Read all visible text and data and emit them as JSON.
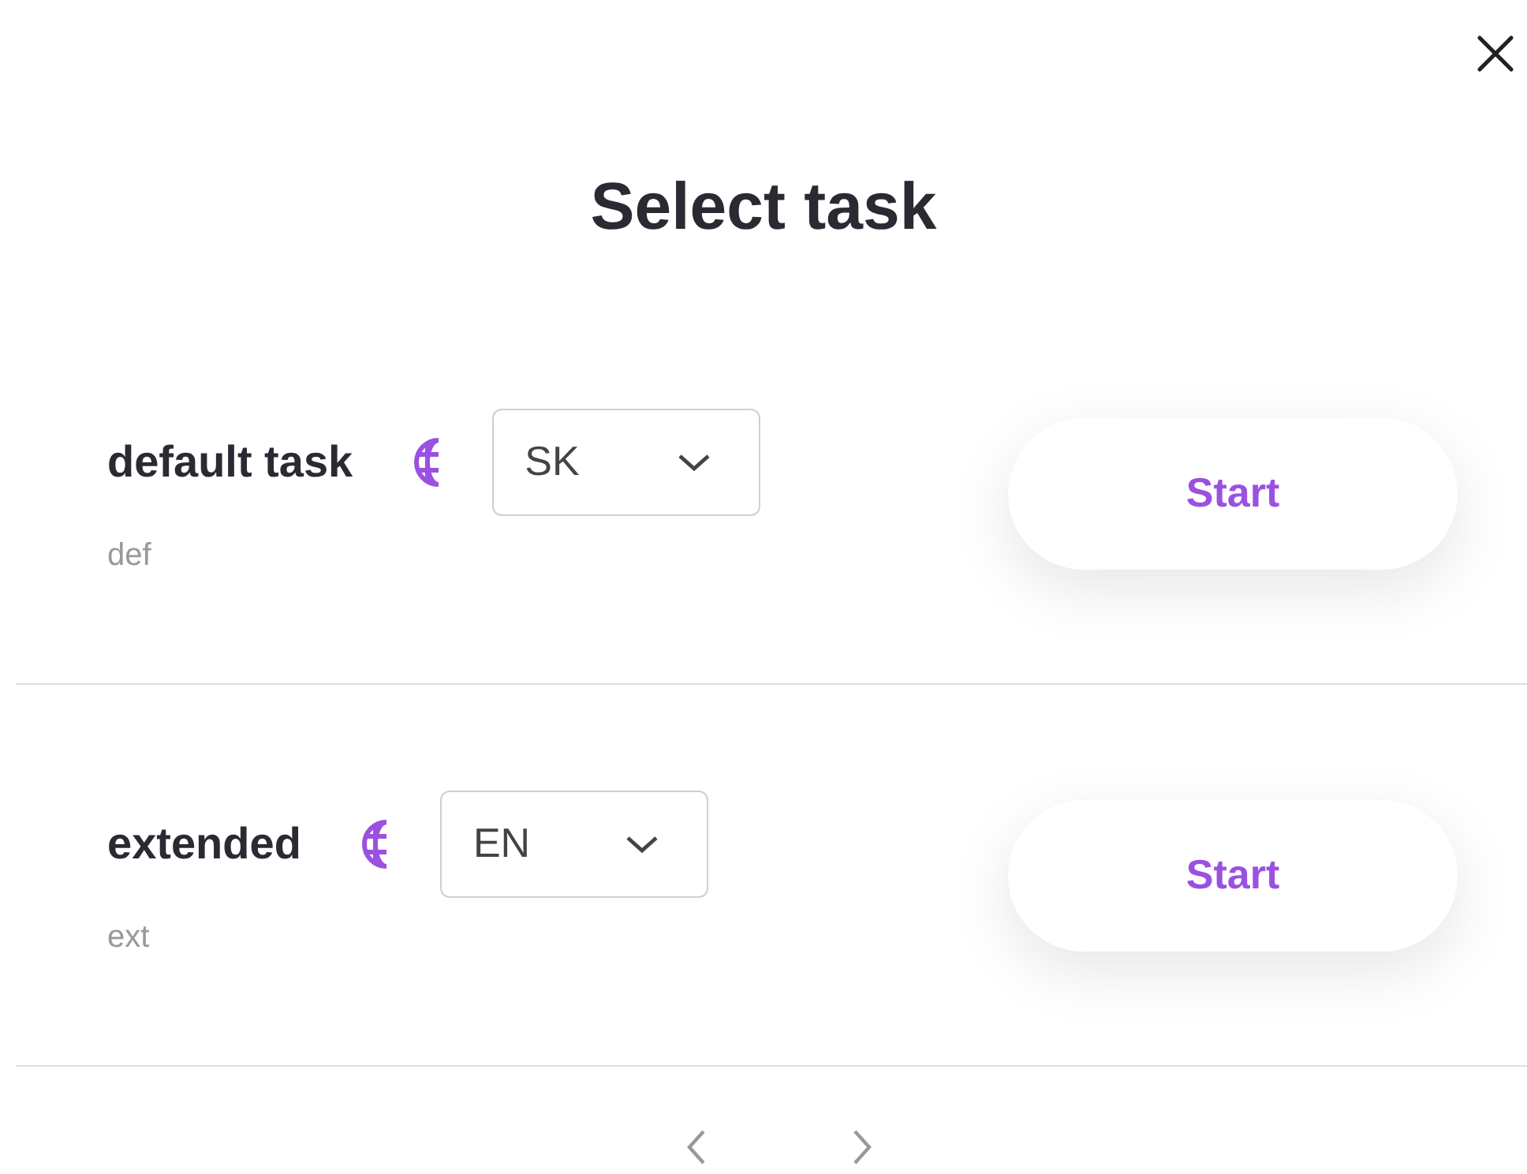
{
  "title": "Select task",
  "tasks": [
    {
      "name": "default task",
      "description": "def",
      "language": "SK",
      "button": "Start"
    },
    {
      "name": "extended",
      "description": "ext",
      "language": "EN",
      "button": "Start"
    }
  ]
}
